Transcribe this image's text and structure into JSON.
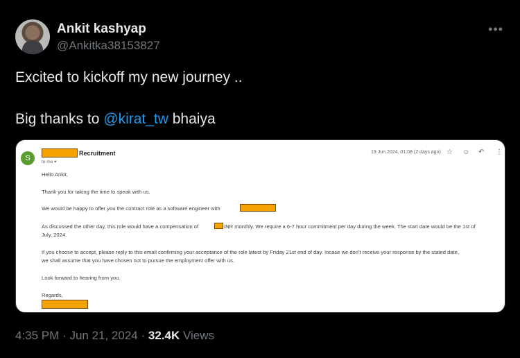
{
  "author": {
    "name": "Ankit kashyap",
    "handle": "@Ankitka38153827"
  },
  "tweet": {
    "line1": "Excited to kickoff my new journey ..",
    "line2_prefix": "Big thanks to ",
    "mention": "@kirat_tw",
    "line2_suffix": " bhaiya"
  },
  "more_label": "•••",
  "email": {
    "avatar_letter": "S",
    "sender_suffix": "Recruitment",
    "to": "to me ▾",
    "date": "19 Jun 2024, 01:08 (2 days ago)",
    "greeting": "Hello Ankit,",
    "p1": "Thank you for taking the time to speak with us.",
    "p2": "We would be happy to offer you the contract role as a software engineer with",
    "p3a_before": "As discussed the other day, this role would have a compensation of",
    "p3a_after": "INR monthly. We require a 6-7 hour commitment per day during the week. The start date would be the 1st of",
    "p3b": "July, 2024.",
    "p4a": "If you choose to accept, please reply to this email confirming your acceptance of the role latest by Friday 21st end of day. Incase we don't receive your response by the stated date,",
    "p4b": "we shall assume that you have chosen not to pursue the employment offer with us.",
    "p5": "Look forward to hearing from you.",
    "signoff": "Regards,",
    "icons": [
      "star-icon",
      "emoji-icon",
      "reply-icon",
      "more-vert-icon"
    ],
    "redaction_color": "#f5a300"
  },
  "footer": {
    "time": "4:35 PM",
    "date": "Jun 21, 2024",
    "views_count": "32.4K",
    "views_label": "Views"
  },
  "colors": {
    "mention": "#1d9bf0",
    "muted": "#71767b",
    "text": "#e7e9ea"
  }
}
